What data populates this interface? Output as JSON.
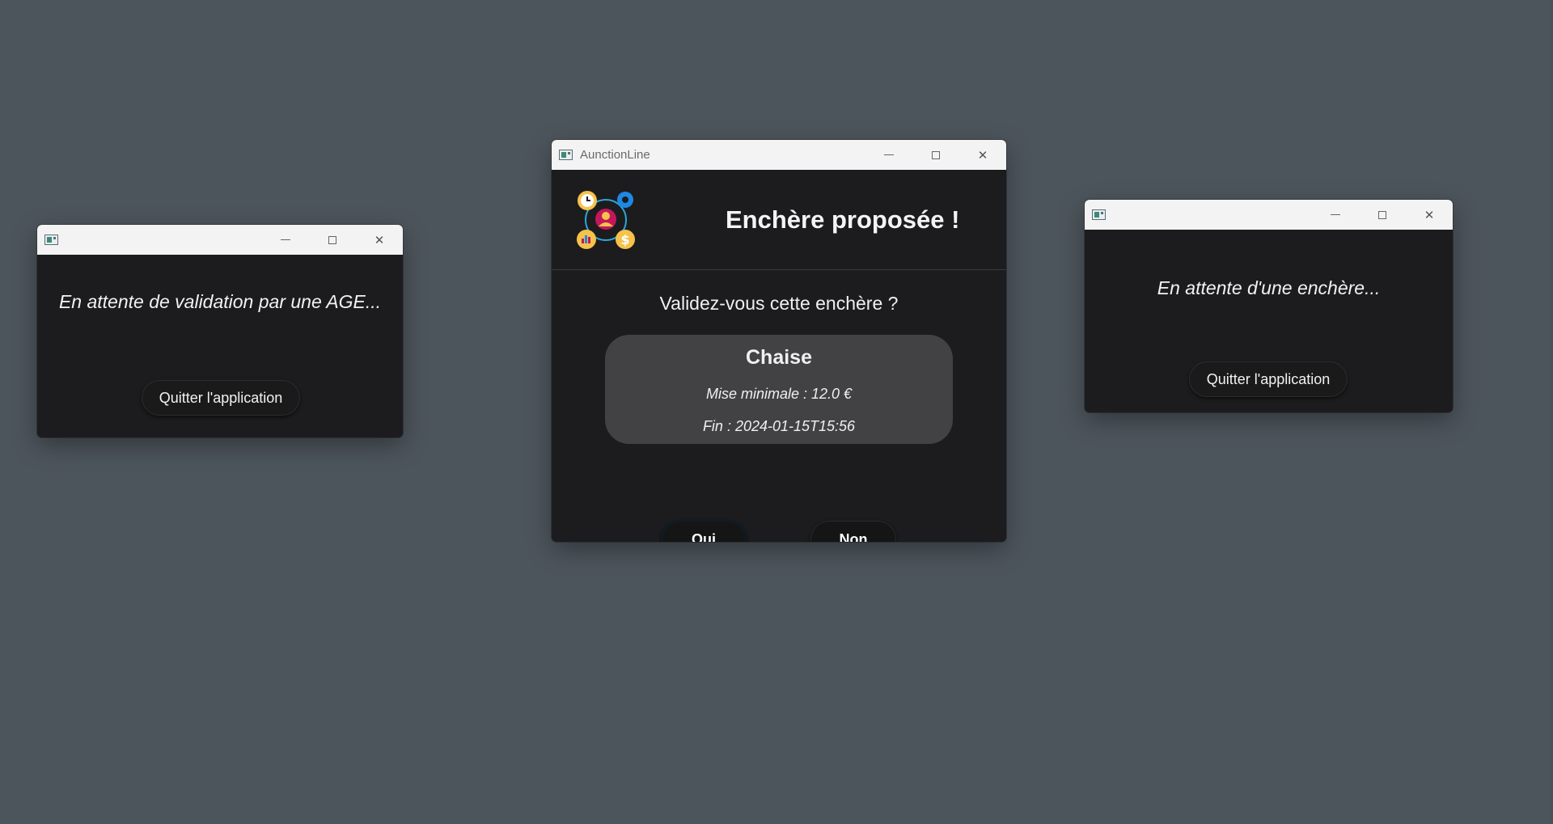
{
  "left_window": {
    "title": "",
    "message": "En attente de validation par une AGE...",
    "quit_button": "Quitter l'application"
  },
  "center_window": {
    "title": "AunctionLine",
    "header_title": "Enchère proposée !",
    "logo_icon": "auction-people-icon",
    "question": "Validez-vous cette enchère ?",
    "item": {
      "name": "Chaise",
      "min_bid": "Mise minimale : 12.0 €",
      "end": "Fin : 2024-01-15T15:56"
    },
    "yes_button": "Oui",
    "no_button": "Non"
  },
  "right_window": {
    "title": "",
    "message": "En attente d'une enchère...",
    "quit_button": "Quitter l'application"
  },
  "colors": {
    "desktop": "#4d555c",
    "window_bg": "#1c1c1e",
    "card_bg": "#424244",
    "titlebar": "#f3f3f3"
  }
}
